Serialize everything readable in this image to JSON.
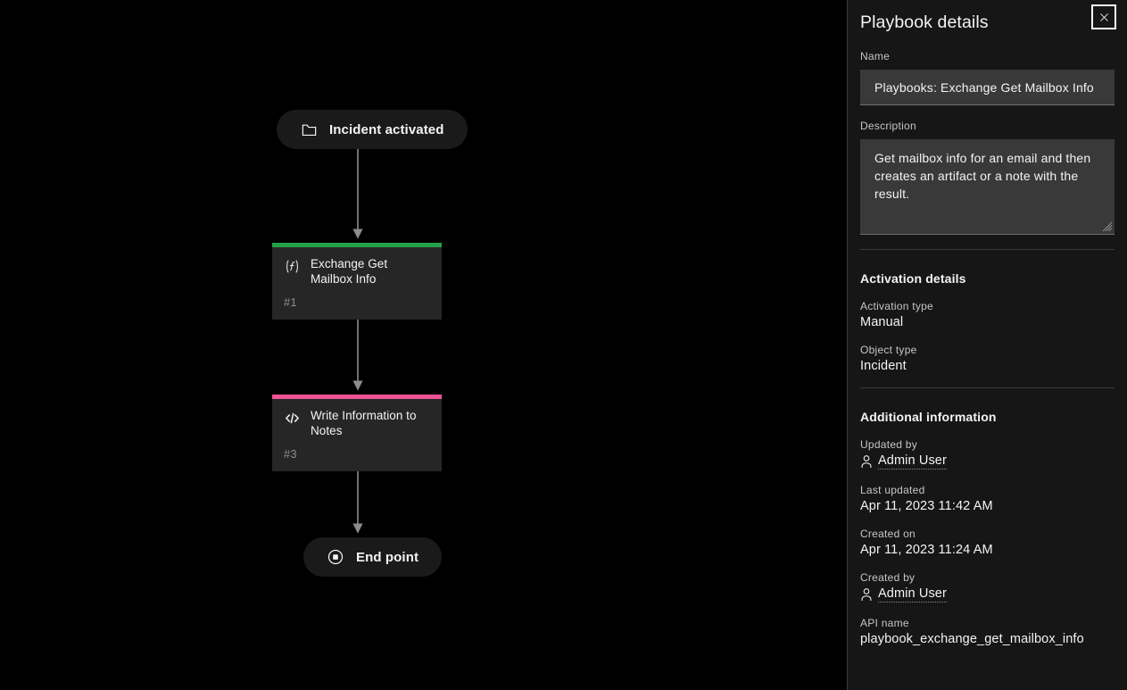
{
  "canvas": {
    "nodes": [
      {
        "id": "start",
        "kind": "pill",
        "icon": "folder-icon",
        "label": "Incident activated"
      },
      {
        "id": "node-1",
        "kind": "action",
        "icon": "function-icon",
        "title": "Exchange Get Mailbox Info",
        "index": "#1",
        "accent": "#24a148"
      },
      {
        "id": "node-3",
        "kind": "action",
        "icon": "code-icon",
        "title": "Write Information to Notes",
        "index": "#3",
        "accent": "#ee5396"
      },
      {
        "id": "end",
        "kind": "pill",
        "icon": "stop-circle-icon",
        "label": "End point"
      }
    ],
    "connector_color": "#8d8d8d"
  },
  "panel": {
    "title": "Playbook details",
    "close_label": "×",
    "name": {
      "label": "Name",
      "value": "Playbooks: Exchange Get Mailbox Info",
      "placeholder": "Name"
    },
    "description": {
      "label": "Description",
      "value": "Get mailbox info for an email and then creates an artifact or a note with the result.",
      "placeholder": "Description"
    },
    "activation": {
      "heading": "Activation details",
      "fields": [
        {
          "label": "Activation type",
          "value": "Manual"
        },
        {
          "label": "Object type",
          "value": "Incident"
        }
      ]
    },
    "additional": {
      "heading": "Additional information",
      "updated_by_label": "Updated by",
      "updated_by_value": "Admin User",
      "last_updated_label": "Last updated",
      "last_updated_value": "Apr 11, 2023 11:42 AM",
      "created_on_label": "Created on",
      "created_on_value": "Apr 11, 2023 11:24 AM",
      "created_by_label": "Created by",
      "created_by_value": "Admin User",
      "api_name_label": "API name",
      "api_name_value": "playbook_exchange_get_mailbox_info"
    }
  }
}
